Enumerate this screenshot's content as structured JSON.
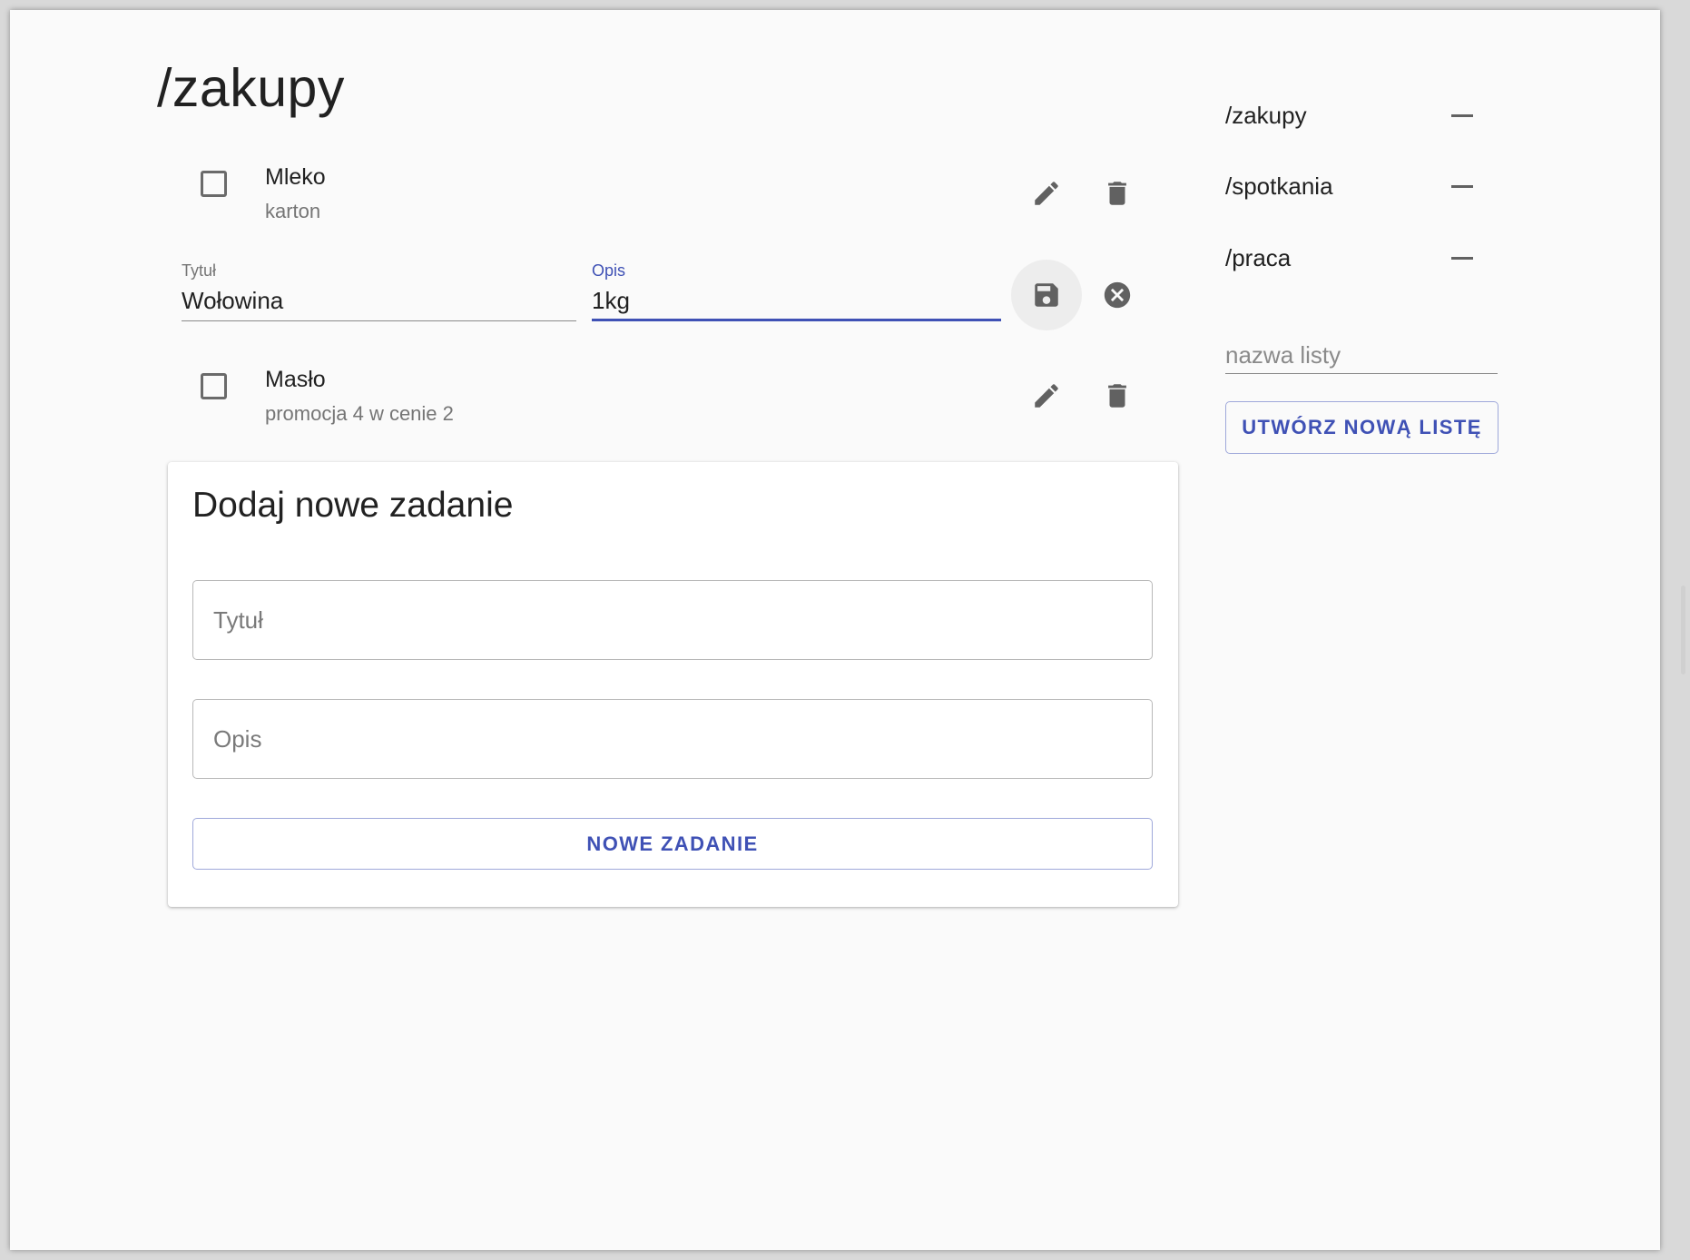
{
  "page": {
    "title": "/zakupy"
  },
  "tasks": [
    {
      "title": "Mleko",
      "description": "karton",
      "checked": false
    },
    {
      "title": "Masło",
      "description": "promocja 4 w cenie 2",
      "checked": false
    }
  ],
  "editing_task": {
    "title_label": "Tytuł",
    "title_value": "Wołowina",
    "desc_label": "Opis",
    "desc_value": "1kg",
    "focused_field": "Opis"
  },
  "new_task_card": {
    "heading": "Dodaj nowe zadanie",
    "title_placeholder": "Tytuł",
    "desc_placeholder": "Opis",
    "submit_label": "NOWE ZADANIE"
  },
  "sidebar": {
    "lists": [
      {
        "name": "/zakupy"
      },
      {
        "name": "/spotkania"
      },
      {
        "name": "/praca"
      }
    ],
    "new_list_placeholder": "nazwa listy",
    "create_button_label": "UTWÓRZ NOWĄ LISTĘ"
  },
  "icons": {
    "edit": "pencil-icon",
    "delete": "trash-icon",
    "save": "floppy-disk-icon",
    "cancel": "close-circle-icon",
    "remove_list": "minus-icon"
  },
  "colors": {
    "accent": "#3f51b5",
    "icon": "#616161",
    "background": "#fafafa"
  }
}
